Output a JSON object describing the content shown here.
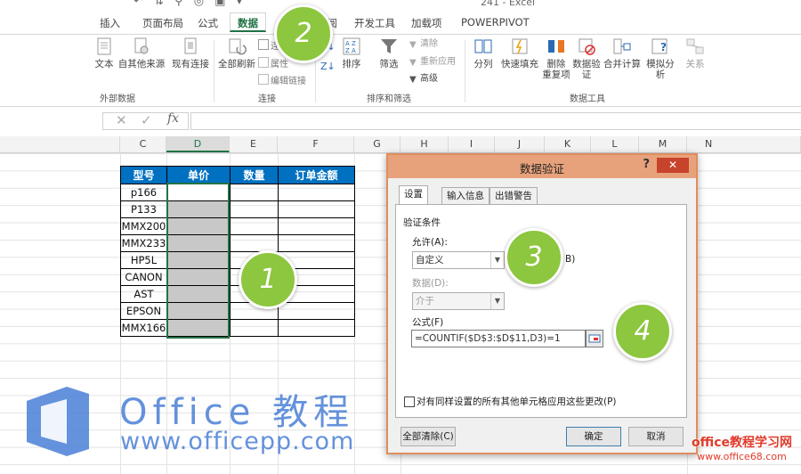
{
  "window": {
    "title": "241 - Excel",
    "quick_access": "↶ ⇅ ⚲ ◎ ▣ ▾"
  },
  "tabs": [
    "插入",
    "页面布局",
    "公式",
    "数据",
    "审阅",
    "开发工具",
    "加载项",
    "POWERPIVOT"
  ],
  "active_tab": "数据",
  "ribbon": {
    "external": {
      "b1": "文本",
      "b2": "自其他来源",
      "b3": "现有连接",
      "group": "外部数据"
    },
    "connections": {
      "refresh": "全部刷新",
      "s1": "连接",
      "s2": "属性",
      "s3": "编辑链接",
      "group": "连接"
    },
    "sort": {
      "sort": "排序",
      "filter": "筛选",
      "clear": "清除",
      "reapply": "重新应用",
      "advanced": "高级",
      "group": "排序和筛选"
    },
    "tools": {
      "split": "分列",
      "flash": "快速填充",
      "remove1": "删除",
      "remove2": "重复项",
      "valid1": "数据验",
      "valid2": "证",
      "consolidate": "合并计算",
      "whatif": "模拟分析",
      "relations": "关系",
      "group": "数据工具"
    }
  },
  "formula_bar": {
    "cancel": "✕",
    "enter": "✓",
    "fx": "fx",
    "value": ""
  },
  "columns": [
    "C",
    "D",
    "E",
    "F",
    "G",
    "H",
    "I",
    "J",
    "K",
    "L",
    "M",
    "N"
  ],
  "table": {
    "headers": [
      "型号",
      "单价",
      "数量",
      "订单金额"
    ],
    "rows": [
      "p166",
      "P133",
      "MMX200",
      "MMX233",
      "HP5L",
      "CANON",
      "AST",
      "EPSON",
      "MMX166"
    ]
  },
  "steps": [
    "1",
    "2",
    "3",
    "4"
  ],
  "dialog": {
    "title": "数据验证",
    "help": "?",
    "close": "✕",
    "tabs": [
      "设置",
      "输入信息",
      "出错警告"
    ],
    "section": "验证条件",
    "allow_label": "允许(A):",
    "allow_value": "自定义",
    "ignore_blank_partial": "B)",
    "data_label": "数据(D):",
    "data_value": "介于",
    "formula_label": "公式(F)",
    "formula_value": "=COUNTIF($D$3:$D$11,D3)=1",
    "apply_all": "对有同样设置的所有其他单元格应用这些更改(P)",
    "clear_all": "全部清除(C)",
    "ok": "确定",
    "cancel": "取消"
  },
  "watermark": {
    "brand": "Office 教程",
    "url": "www.officepp.com",
    "site2_name": "office教程学习网",
    "site2_url": "www.office68.com"
  },
  "colors": {
    "excel_green": "#217346",
    "header_blue": "#0070c0",
    "step_green": "#8dc63f",
    "dialog_border": "#e08d5e"
  }
}
